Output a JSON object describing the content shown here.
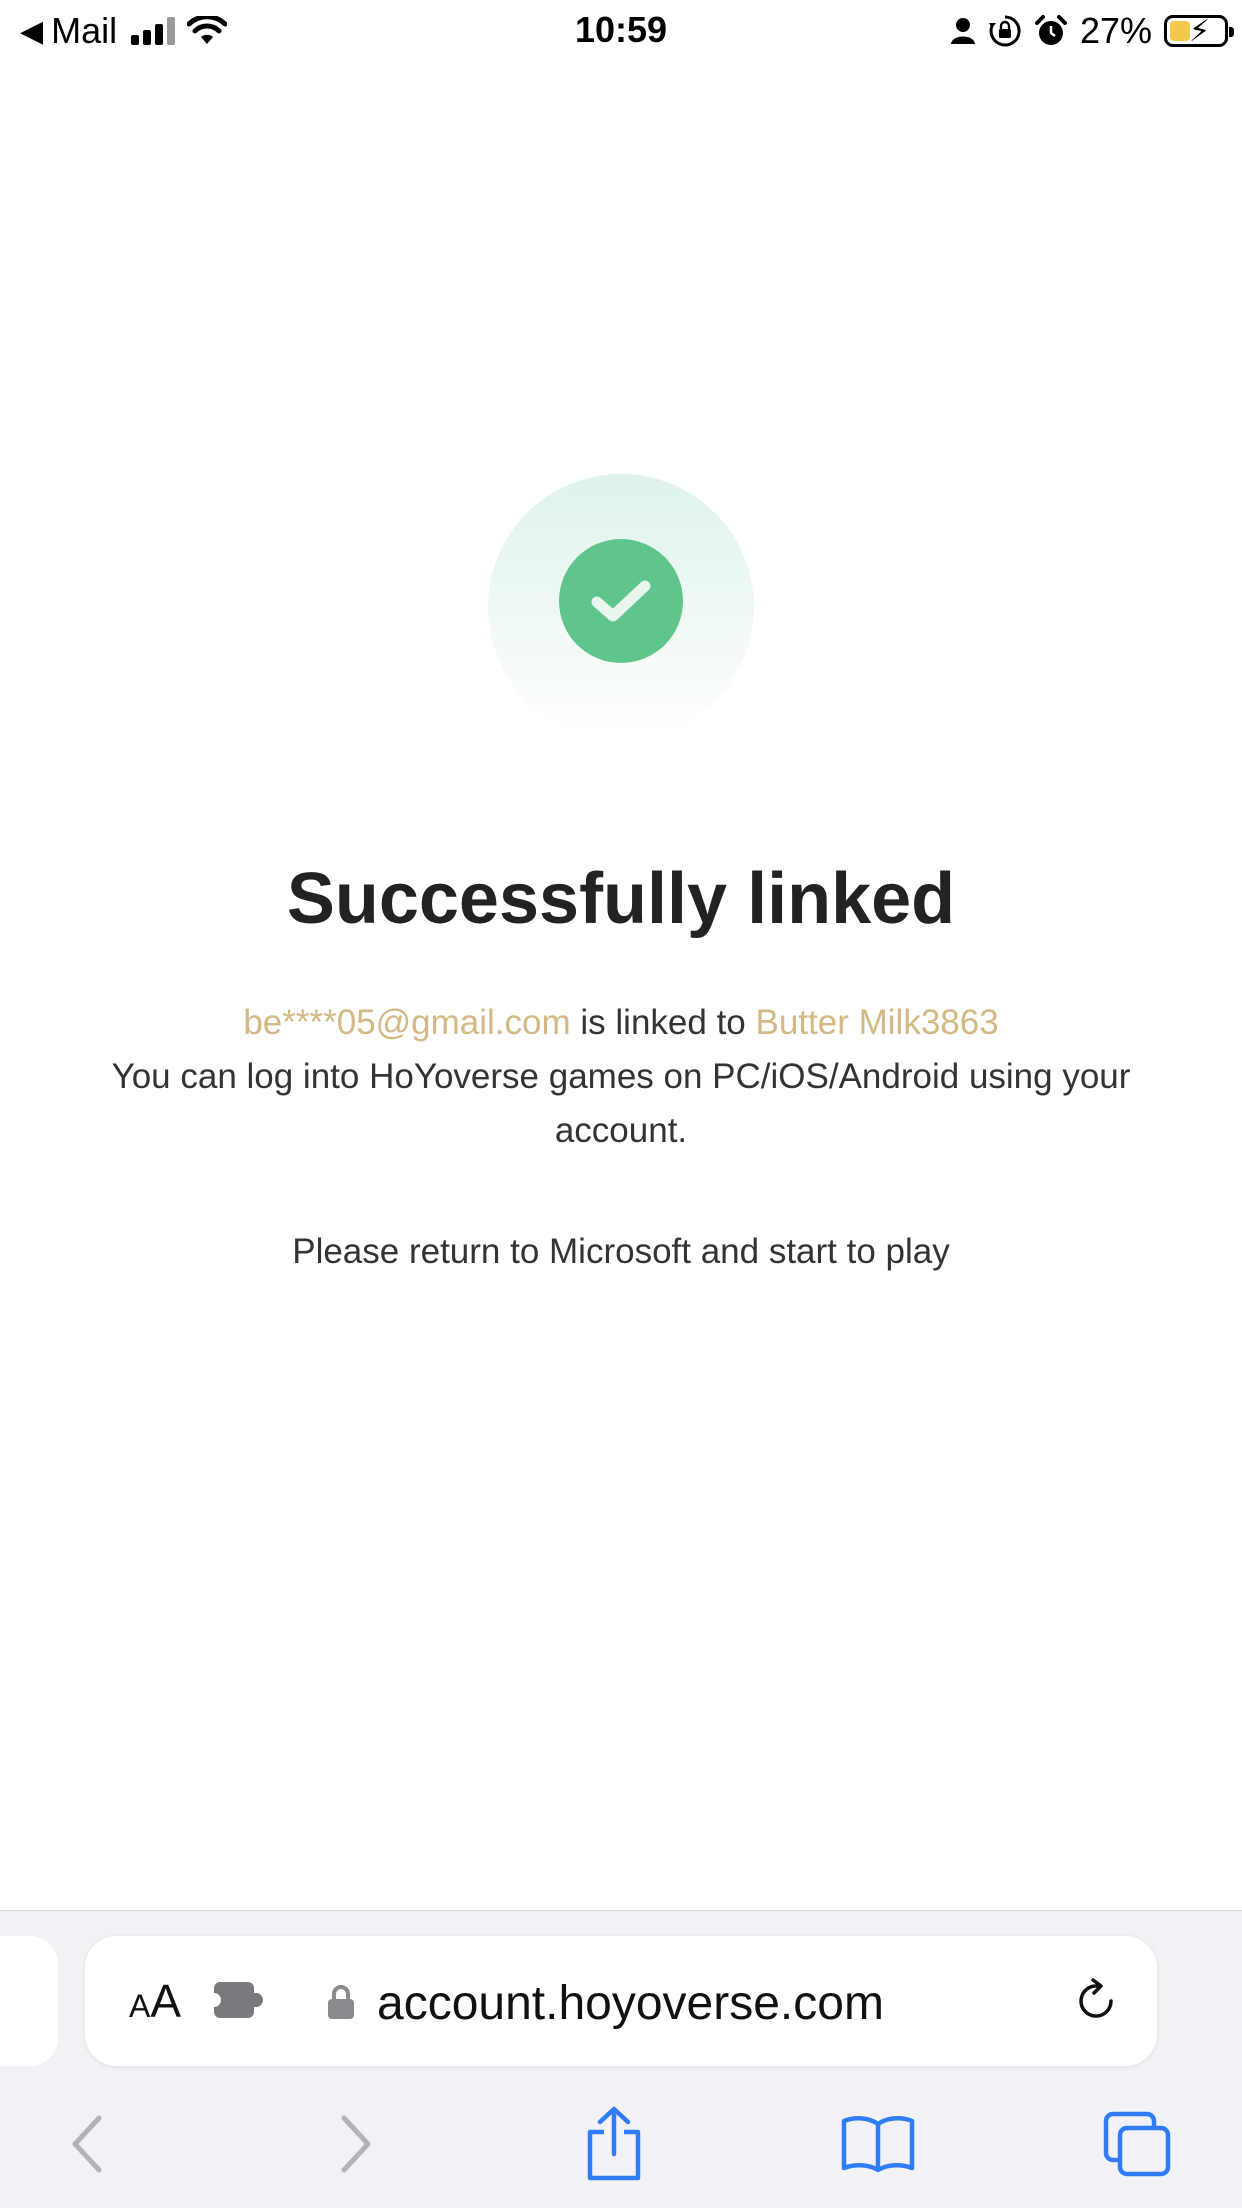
{
  "status_bar": {
    "back_app": "Mail",
    "time": "10:59",
    "battery_percent": "27%",
    "battery_level": 0.27
  },
  "content": {
    "title": "Successfully linked",
    "email": "be****05@gmail.com",
    "linked_to_text": "is linked to",
    "account_name": "Butter Milk3863",
    "login_info": "You can log into HoYoverse games on PC/iOS/Android using your account.",
    "return_text": "Please return to Microsoft and start to play"
  },
  "browser": {
    "text_size_label_small": "A",
    "text_size_label_large": "A",
    "url": "account.hoyoverse.com"
  },
  "colors": {
    "accent_gold": "#d3b984",
    "success_green": "#5fc58c",
    "ios_blue": "#2f7cf6"
  },
  "icons": {
    "success": "checkmark-icon",
    "lock": "lock-icon",
    "reload": "reload-icon",
    "back": "chevron-left-icon",
    "forward": "chevron-right-icon",
    "share": "share-icon",
    "bookmarks": "book-icon",
    "tabs": "tabs-icon"
  }
}
